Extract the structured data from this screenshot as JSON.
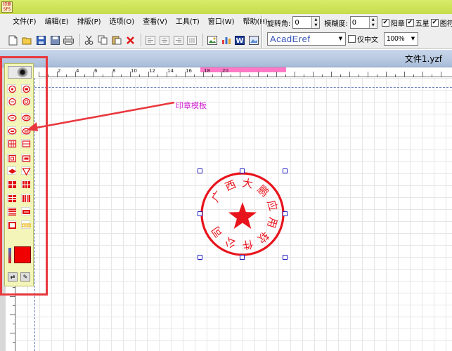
{
  "app": {
    "icon_text": "印章\nSFS"
  },
  "menu": [
    "文件(F)",
    "编辑(E)",
    "排版(P)",
    "选项(O)",
    "查看(V)",
    "工具(T)",
    "窗口(W)",
    "帮助(H)"
  ],
  "toolbar_icons": [
    "new-icon",
    "open-icon",
    "save-icon",
    "save-as-icon",
    "print-icon",
    "cut-icon",
    "copy-icon",
    "paste-icon",
    "delete-icon",
    "align-left-icon",
    "align-center-icon",
    "align-right-icon",
    "distribute-icon",
    "image-icon",
    "chart-icon",
    "word-icon",
    "picture-icon"
  ],
  "properties": {
    "rotate_label": "旋转角:",
    "rotate_value": "0",
    "blur_label": "模糊度:",
    "blur_value": "0",
    "yangzhang_label": "阳章",
    "yangzhang_checked": true,
    "wuxing_label": "五星",
    "wuxing_checked": true,
    "tufu_label": "图符",
    "tufu_checked": true,
    "font_value": "AcadEref",
    "zhongwen_label": "仅中文",
    "zhongwen_checked": false,
    "zoom_value": "100%"
  },
  "document": {
    "title": "文件1.yzf"
  },
  "ruler": {
    "labels": [
      "2",
      "4",
      "6",
      "8",
      "10",
      "12",
      "14",
      "16",
      "18",
      "20"
    ],
    "highlight_color": "#ff79c6"
  },
  "annotation": {
    "label": "印章模板"
  },
  "stamp": {
    "text": "广西大鹏应用软件公司",
    "color": "#e8141c"
  },
  "panel": {
    "active_color": "#f00000",
    "highlight_color": "#e8383e"
  }
}
